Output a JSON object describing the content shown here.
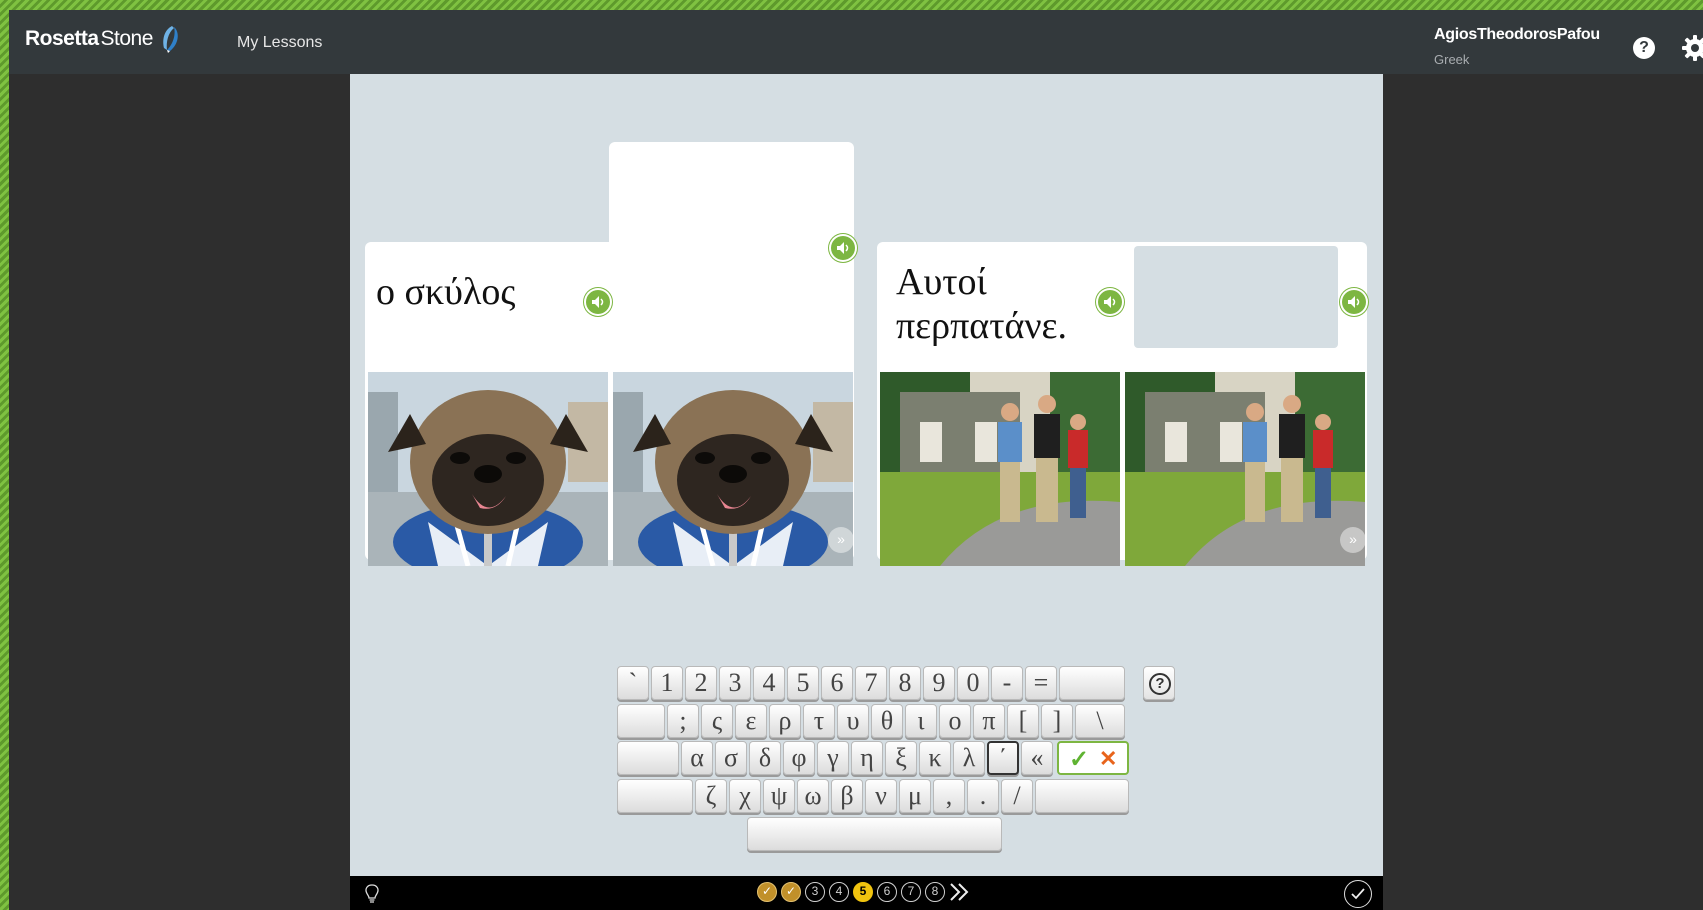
{
  "header": {
    "brand_bold": "Rosetta",
    "brand_light": "Stone",
    "nav_my_lessons": "My Lessons",
    "user_name": "AgiosTheodorosPafou",
    "user_language": "Greek",
    "help_label": "?"
  },
  "cards": [
    {
      "prompt_text": "ο σκύλος",
      "image": "pug-in-jacket-photo",
      "answer": ""
    },
    {
      "prompt_line1": "Αυτοί",
      "prompt_line2": "περπατάνε.",
      "image": "three-men-walking-photo",
      "answer": ""
    }
  ],
  "keyboard": {
    "row1": [
      "`",
      "1",
      "2",
      "3",
      "4",
      "5",
      "6",
      "7",
      "8",
      "9",
      "0",
      "-",
      "=",
      ""
    ],
    "row2": [
      "",
      ";",
      "ς",
      "ε",
      "ρ",
      "τ",
      "υ",
      "θ",
      "ι",
      "ο",
      "π",
      "[",
      "]",
      "\\"
    ],
    "row3": [
      "",
      "α",
      "σ",
      "δ",
      "φ",
      "γ",
      "η",
      "ξ",
      "κ",
      "λ",
      "΄",
      "«"
    ],
    "row4": [
      "",
      "ζ",
      "χ",
      "ψ",
      "ω",
      "β",
      "ν",
      "μ",
      ",",
      ".",
      "/",
      ""
    ],
    "space": "",
    "help_label": "?",
    "accent_check": "✓",
    "accent_cross": "✕"
  },
  "progress": {
    "items": [
      "✓",
      "✓",
      "3",
      "4",
      "5",
      "6",
      "7",
      "8"
    ],
    "current": 5,
    "next_icon": "double-chevron-right-icon"
  },
  "colors": {
    "header_bg": "#33393c",
    "lesson_bg": "#d5dee3",
    "audio_green": "#7db642",
    "done_gold": "#c1902a",
    "current_yellow": "#f1c40f",
    "border_green": "#7fc241"
  }
}
